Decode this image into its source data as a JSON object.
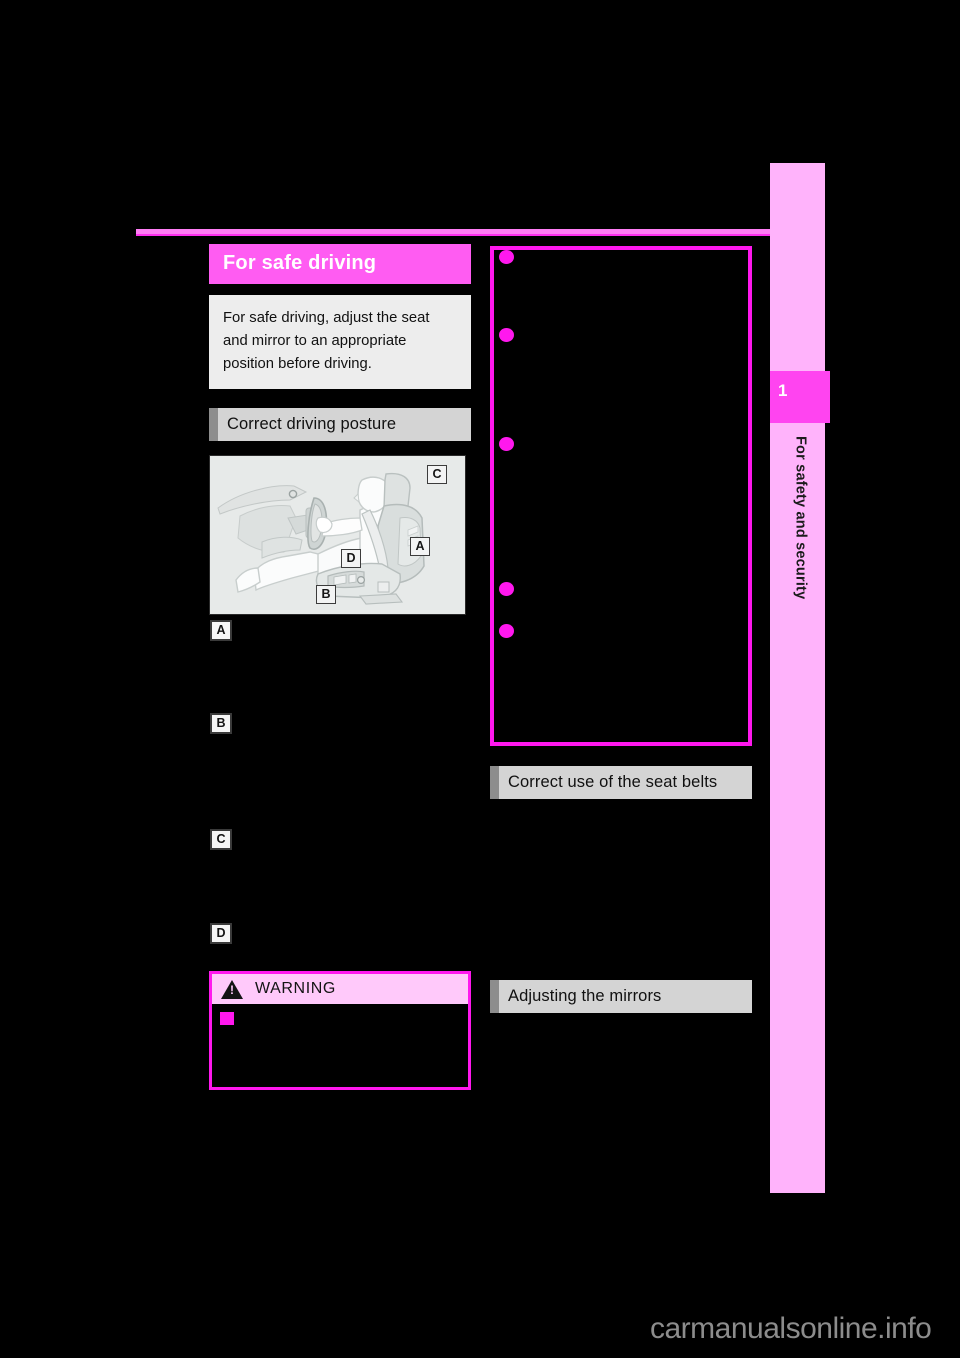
{
  "page": {
    "background_color": "#000000",
    "watermark": "carmanualsonline.info"
  },
  "side_tab": {
    "chapter_number": "1",
    "chapter_label": "For safety and security",
    "strip_color": "#ffb3fb",
    "tab_color": "#ff44f0"
  },
  "left_column": {
    "section_title": "For safe driving",
    "section_title_color": "#ff5cf2",
    "intro_text": "For safe driving, adjust the seat and mirror to an appropriate position before driving.",
    "sub_header": "Correct driving posture",
    "figure": {
      "caption_labels": [
        "A",
        "B",
        "C",
        "D"
      ],
      "alt": "Driver seated in correct driving posture with callouts A (seatback), B (seat position control), C (head restraint), D (steering wheel)"
    },
    "items": [
      {
        "marker": "A",
        "text": ""
      },
      {
        "marker": "B",
        "text": ""
      },
      {
        "marker": "C",
        "text": ""
      },
      {
        "marker": "D",
        "text": ""
      }
    ],
    "warning": {
      "label": "WARNING",
      "icon": "warning-triangle-icon",
      "header_color": "#ffc9fa",
      "border_color": "#ff18ee",
      "bullet_color": "#ff18ee",
      "text": ""
    }
  },
  "right_column": {
    "notice_box": {
      "border_color": "#ff18ee",
      "bullet_color": "#ff18ee",
      "bullets": [
        {
          "text": ""
        },
        {
          "text": ""
        },
        {
          "text": ""
        },
        {
          "text": ""
        },
        {
          "text": ""
        }
      ]
    },
    "headers": [
      {
        "text": "Correct use of the seat belts"
      },
      {
        "text": "Adjusting the mirrors"
      }
    ]
  }
}
